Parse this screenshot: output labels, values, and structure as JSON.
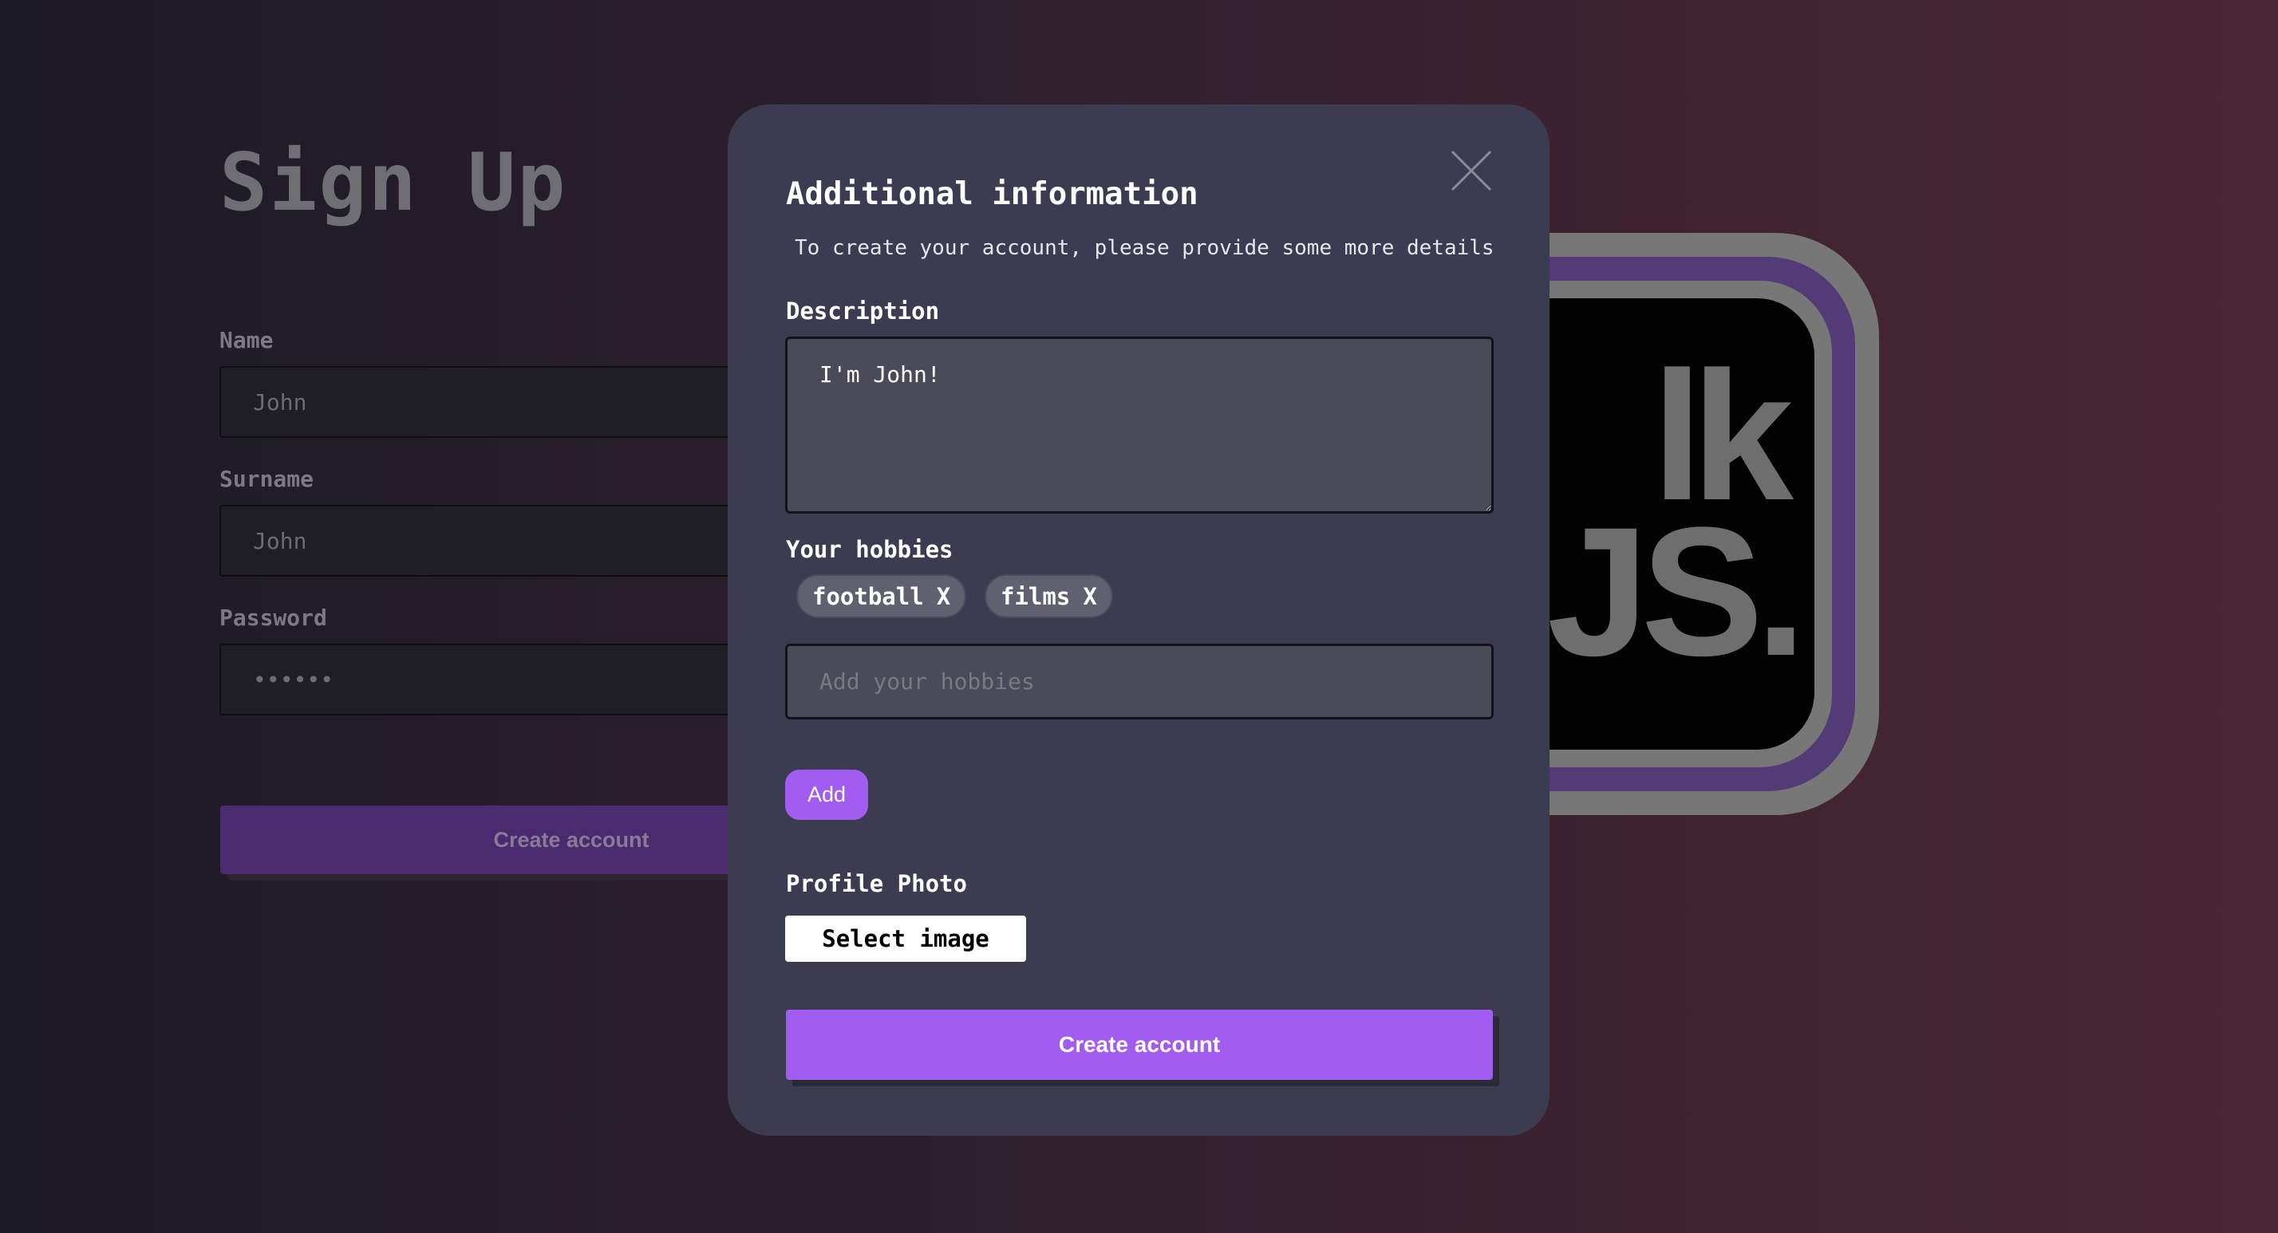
{
  "signup": {
    "title": "Sign Up",
    "name_label": "Name",
    "name_value": "John",
    "surname_label": "Surname",
    "surname_value": "John",
    "password_label": "Password",
    "password_value": "••••••",
    "create_label": "Create account"
  },
  "logo": {
    "line1": "lk",
    "line2": "JS."
  },
  "modal": {
    "title": "Additional information",
    "subtitle": "To create your account, please provide some more details",
    "description_label": "Description",
    "description_value": "I'm John!",
    "hobbies_label": "Your hobbies",
    "hobbies": [
      {
        "name": "football",
        "remove": "X"
      },
      {
        "name": "films",
        "remove": "X"
      }
    ],
    "hobby_placeholder": "Add your hobbies",
    "add_label": "Add",
    "photo_label": "Profile Photo",
    "select_image_label": "Select image",
    "create_label": "Create account",
    "close_icon": "close-icon"
  },
  "colors": {
    "accent": "#a35cf0",
    "modal_bg": "#3b3c51",
    "input_bg": "#4a4a58"
  }
}
